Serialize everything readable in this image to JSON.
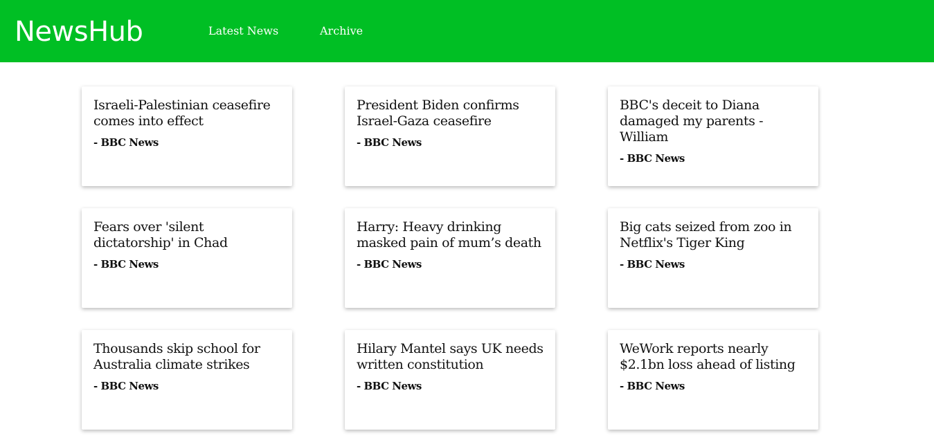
{
  "header": {
    "logo": "NewsHub",
    "nav": [
      {
        "label": "Latest News"
      },
      {
        "label": "Archive"
      }
    ],
    "background": "#00bf24"
  },
  "articles": [
    {
      "title": "Israeli-Palestinian ceasefire comes into effect",
      "source": "- BBC News"
    },
    {
      "title": "President Biden confirms Israel-Gaza ceasefire",
      "source": "- BBC News"
    },
    {
      "title": "BBC's deceit to Diana damaged my parents - William",
      "source": "- BBC News"
    },
    {
      "title": "Fears over 'silent dictatorship' in Chad",
      "source": "- BBC News"
    },
    {
      "title": "Harry: Heavy drinking masked pain of mum’s death",
      "source": "- BBC News"
    },
    {
      "title": "Big cats seized from zoo in Netflix's Tiger King",
      "source": "- BBC News"
    },
    {
      "title": "Thousands skip school for Australia climate strikes",
      "source": "- BBC News"
    },
    {
      "title": "Hilary Mantel says UK needs written constitution",
      "source": "- BBC News"
    },
    {
      "title": "WeWork reports nearly $2.1bn loss ahead of listing",
      "source": "- BBC News"
    }
  ]
}
